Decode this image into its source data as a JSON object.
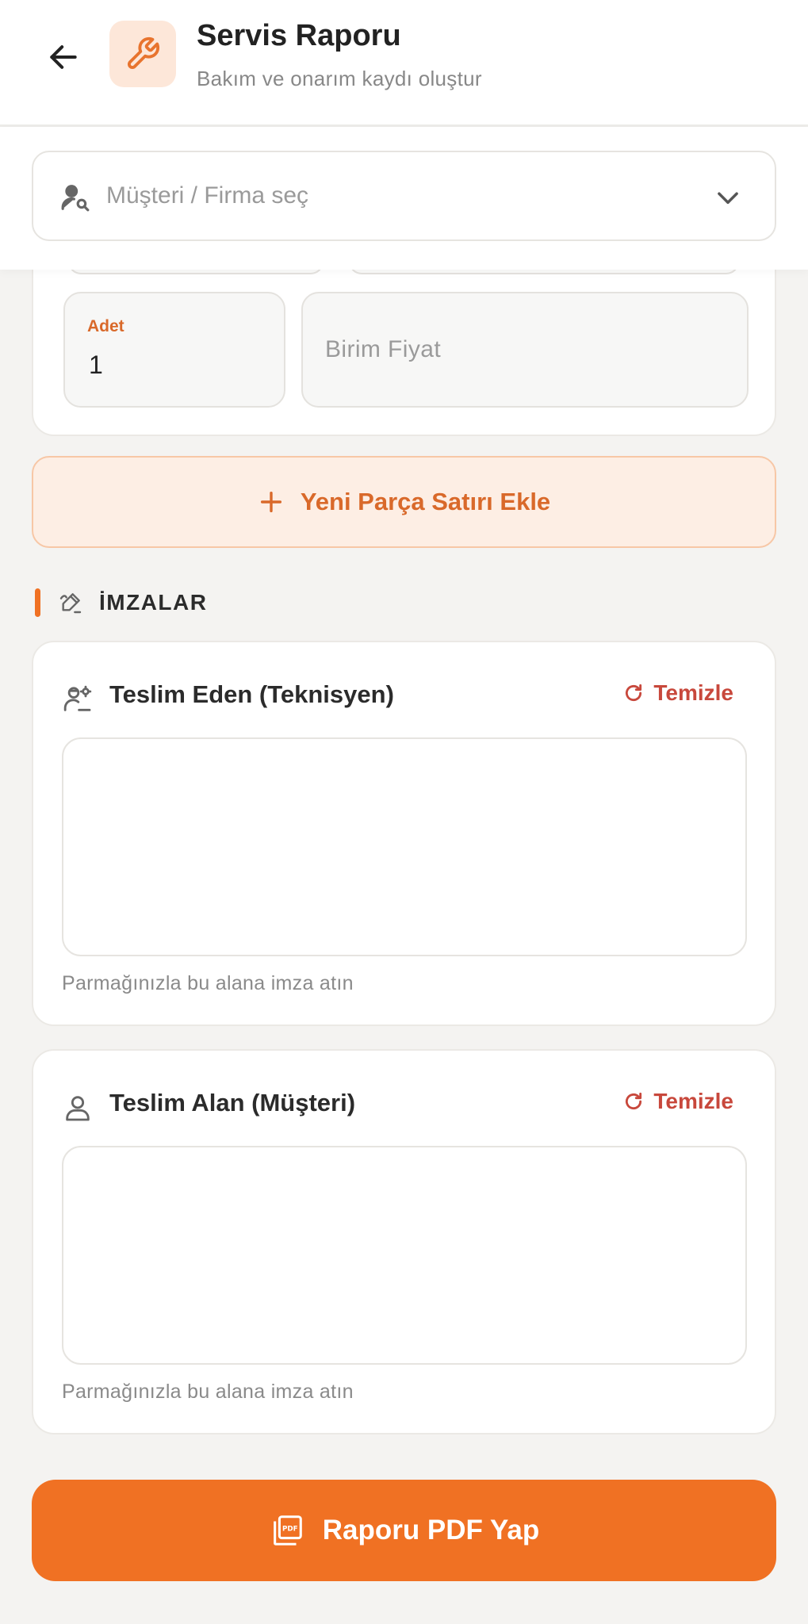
{
  "header": {
    "title": "Servis Raporu",
    "subtitle": "Bakım ve onarım kaydı oluştur",
    "back_icon": "arrow-left-icon",
    "app_icon": "wrench-icon"
  },
  "customer_select": {
    "placeholder": "Müşteri / Firma seç",
    "icon": "user-search-icon"
  },
  "parts": {
    "quantity_label": "Adet",
    "quantity_value": "1",
    "unit_price_placeholder": "Birim Fiyat",
    "add_row_label": "Yeni Parça Satırı Ekle"
  },
  "signatures": {
    "section_title": "İMZALAR",
    "technician": {
      "title": "Teslim Eden (Teknisyen)",
      "clear_label": "Temizle",
      "hint": "Parmağınızla bu alana imza atın"
    },
    "customer": {
      "title": "Teslim Alan (Müşteri)",
      "clear_label": "Temizle",
      "hint": "Parmağınızla bu alana imza atın"
    }
  },
  "actions": {
    "pdf_label": "Raporu PDF Yap"
  },
  "colors": {
    "accent": "#f07123",
    "accent_soft": "#fdeee4",
    "danger": "#c8483c",
    "background": "#f4f3f1"
  }
}
